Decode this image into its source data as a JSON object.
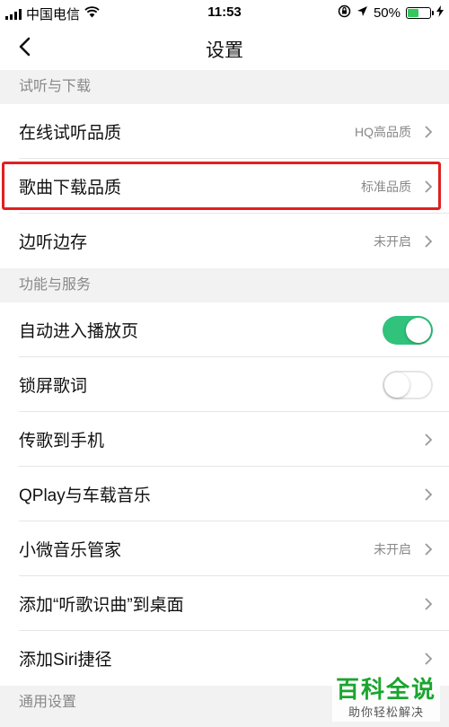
{
  "status_bar": {
    "carrier": "中国电信",
    "time": "11:53",
    "battery": "50%",
    "battery_level": 0.5,
    "icons": [
      "signal-icon",
      "wifi-icon",
      "orientation-lock-icon",
      "location-icon",
      "battery-icon",
      "charging-icon"
    ]
  },
  "nav": {
    "title": "设置",
    "back_icon": "chevron-left-icon"
  },
  "sections": {
    "listen_download": "试听与下载",
    "features_services": "功能与服务",
    "general": "通用设置"
  },
  "rows": {
    "online_quality": {
      "label": "在线试听品质",
      "value": "HQ高品质"
    },
    "download_quality": {
      "label": "歌曲下载品质",
      "value": "标准品质"
    },
    "cache_while_listening": {
      "label": "边听边存",
      "value": "未开启"
    },
    "auto_play_page": {
      "label": "自动进入播放页",
      "toggle": true
    },
    "lock_screen_lyrics": {
      "label": "锁屏歌词",
      "toggle": false
    },
    "transfer_to_phone": {
      "label": "传歌到手机"
    },
    "qplay": {
      "label": "QPlay与车载音乐"
    },
    "xiaowei": {
      "label": "小微音乐管家",
      "value": "未开启"
    },
    "add_shortcut": {
      "label": "添加“听歌识曲”到桌面"
    },
    "siri_shortcut": {
      "label": "添加Siri捷径"
    }
  },
  "colors": {
    "accent_green": "#31c27c",
    "highlight_red": "#e02020",
    "watermark_green": "#1ba52f"
  },
  "watermark": {
    "main": "百科全说",
    "sub": "助你轻松解决"
  }
}
